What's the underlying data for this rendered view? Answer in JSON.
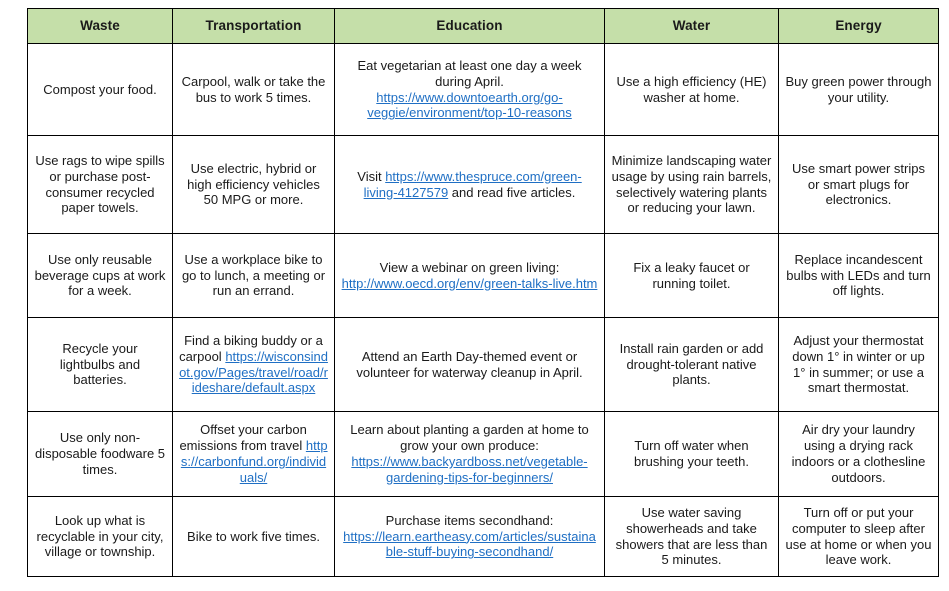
{
  "table": {
    "headers": [
      {
        "label": "Waste"
      },
      {
        "label": "Transportation"
      },
      {
        "label": "Education"
      },
      {
        "label": "Water"
      },
      {
        "label": "Energy"
      }
    ],
    "header_background": "#c5dfa9",
    "link_color": "#1f6fc4",
    "border_color": "#000000",
    "rows": [
      {
        "waste": {
          "text": "Compost your food."
        },
        "transportation": {
          "text": "Carpool, walk or take the bus to work 5 times."
        },
        "education": {
          "text": "Eat vegetarian at least one day a week during April.",
          "link": "https://www.downtoearth.org/go-veggie/environment/top-10-reasons"
        },
        "water": {
          "text": "Use a high efficiency (HE) washer at home."
        },
        "energy": {
          "text": "Buy green power through your utility."
        }
      },
      {
        "waste": {
          "text": "Use rags to wipe spills or purchase post-consumer recycled paper towels."
        },
        "transportation": {
          "text": "Use electric, hybrid or high efficiency vehicles 50 MPG or more."
        },
        "education": {
          "prefix": "Visit ",
          "link": "https://www.thespruce.com/green-living-4127579",
          "suffix": " and read five articles."
        },
        "water": {
          "text": "Minimize landscaping water usage by using rain barrels, selectively watering plants or reducing your lawn."
        },
        "energy": {
          "text": "Use smart power strips or smart plugs for electronics."
        }
      },
      {
        "waste": {
          "text": "Use only reusable beverage cups at work for a week."
        },
        "transportation": {
          "text": "Use a workplace bike to go to lunch, a meeting or run an errand."
        },
        "education": {
          "text": "View a webinar on green living:",
          "link": "http://www.oecd.org/env/green-talks-live.htm"
        },
        "water": {
          "text": "Fix a leaky faucet or running toilet."
        },
        "energy": {
          "text": "Replace incandescent bulbs with LEDs and turn off lights."
        }
      },
      {
        "waste": {
          "text": "Recycle your lightbulbs and batteries."
        },
        "transportation": {
          "text": "Find a biking buddy or a carpool",
          "link": "https://wisconsindot.gov/Pages/travel/road/rideshare/default.aspx"
        },
        "education": {
          "text": "Attend an Earth Day-themed event or volunteer for waterway cleanup in April."
        },
        "water": {
          "text": "Install rain garden or add drought-tolerant native plants."
        },
        "energy": {
          "text": "Adjust your thermostat down 1° in winter or up 1° in summer; or use a smart thermostat."
        }
      },
      {
        "waste": {
          "text": "Use only non-disposable foodware 5 times."
        },
        "transportation": {
          "text": "Offset your carbon emissions from travel",
          "link": "https://carbonfund.org/individuals/"
        },
        "education": {
          "text": "Learn about planting a garden at home to grow your own produce:",
          "link": "https://www.backyardboss.net/vegetable-gardening-tips-for-beginners/"
        },
        "water": {
          "text": "Turn off water when brushing your teeth."
        },
        "energy": {
          "text": "Air dry your laundry using a drying rack indoors or a clothesline outdoors."
        }
      },
      {
        "waste": {
          "text": "Look up what is recyclable in your city, village or township."
        },
        "transportation": {
          "text": "Bike to work five times."
        },
        "education": {
          "text": "Purchase items secondhand:",
          "link": "https://learn.eartheasy.com/articles/sustainable-stuff-buying-secondhand/"
        },
        "water": {
          "text": "Use water saving showerheads and take showers that are less than 5 minutes."
        },
        "energy": {
          "text": "Turn off or put your computer to sleep after use at home or when you leave work."
        }
      }
    ]
  }
}
